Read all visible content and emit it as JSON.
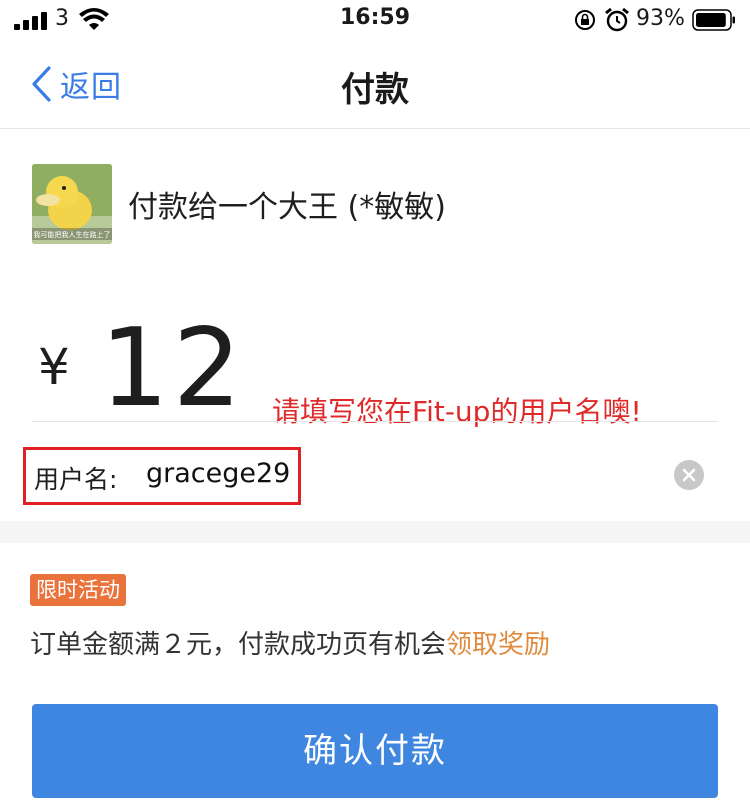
{
  "status_bar": {
    "carrier": "3",
    "time": "16:59",
    "battery_percent": "93%",
    "battery_level": 0.93,
    "icons": [
      "signal-icon",
      "wifi-icon",
      "rotation-lock-icon",
      "alarm-icon",
      "battery-icon"
    ]
  },
  "nav": {
    "back_label": "返回",
    "title": "付款"
  },
  "payee": {
    "avatar_caption": "我可能把我人生在路上了",
    "name": "付款给一个大王 (*敏敏)"
  },
  "amount": {
    "currency": "¥",
    "value": "12"
  },
  "annotation": {
    "hint": "请填写您在Fit-up的用户名噢!"
  },
  "username": {
    "label": "用户名:",
    "value": "gracege29"
  },
  "promotion": {
    "tag": "限时活动",
    "text": "订单金额满２元，付款成功页有机会",
    "link": "领取奖励"
  },
  "confirm": {
    "label": "确认付款"
  },
  "colors": {
    "accent_blue": "#3e86df",
    "nav_blue": "#3a7ce6",
    "hint_red": "#e02a2a",
    "box_red": "#e01f26",
    "promo_orange": "#e9733a",
    "link_orange": "#e08a3c"
  }
}
